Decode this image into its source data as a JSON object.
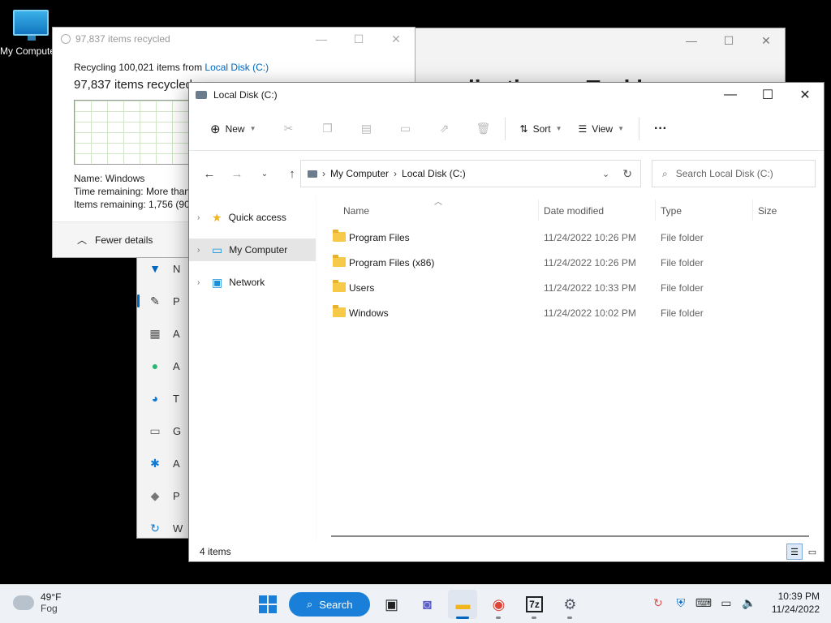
{
  "desktop": {
    "icon_label": "My Computer"
  },
  "settings_window": {
    "heading": "…lications > Taskb",
    "nav": [
      {
        "icon": "wifi-icon",
        "glyph": "▼",
        "color": "#0067c0",
        "label": "N"
      },
      {
        "icon": "brush-icon",
        "glyph": "✎",
        "color": "#333333",
        "label": "P",
        "selected": true
      },
      {
        "icon": "apps-icon",
        "glyph": "▦",
        "color": "#555555",
        "label": "A"
      },
      {
        "icon": "accounts-icon",
        "glyph": "●",
        "color": "#2bb673",
        "label": "A"
      },
      {
        "icon": "time-language-icon",
        "glyph": "◕",
        "color": "#0c7ad4",
        "label": "T"
      },
      {
        "icon": "gaming-icon",
        "glyph": "▭",
        "color": "#666666",
        "label": "G"
      },
      {
        "icon": "accessibility-icon",
        "glyph": "✱",
        "color": "#0c7ad4",
        "label": "A"
      },
      {
        "icon": "privacy-shield-icon",
        "glyph": "◆",
        "color": "#777777",
        "label": "P"
      },
      {
        "icon": "windows-update-icon",
        "glyph": "↻",
        "color": "#0c7ad4",
        "label": "W"
      }
    ]
  },
  "recycle_dialog": {
    "title": "97,837 items recycled",
    "line1_prefix": "Recycling 100,021 items from ",
    "line1_link": "Local Disk (C:)",
    "line2": "97,837 items recycled",
    "name_label": "Name:",
    "name_value": "Windows",
    "time_label": "Time remaining:",
    "time_value": "More than",
    "items_label": "Items remaining:",
    "items_value": "1,756 (90",
    "fewer_details": "Fewer details"
  },
  "explorer": {
    "title": "Local Disk (C:)",
    "toolbar": {
      "new": "New",
      "sort": "Sort",
      "view": "View",
      "more": "···"
    },
    "breadcrumb": [
      "My Computer",
      "Local Disk (C:)"
    ],
    "search_placeholder": "Search Local Disk (C:)",
    "nav_pane": [
      {
        "label": "Quick access",
        "icon": "star-icon"
      },
      {
        "label": "My Computer",
        "icon": "computer-icon",
        "selected": true
      },
      {
        "label": "Network",
        "icon": "network-icon"
      }
    ],
    "columns": {
      "name": "Name",
      "date": "Date modified",
      "type": "Type",
      "size": "Size"
    },
    "files": [
      {
        "name": "Program Files",
        "date": "11/24/2022 10:26 PM",
        "type": "File folder"
      },
      {
        "name": "Program Files (x86)",
        "date": "11/24/2022 10:26 PM",
        "type": "File folder"
      },
      {
        "name": "Users",
        "date": "11/24/2022 10:33 PM",
        "type": "File folder"
      },
      {
        "name": "Windows",
        "date": "11/24/2022 10:02 PM",
        "type": "File folder"
      }
    ],
    "status": "4 items"
  },
  "taskbar": {
    "weather_temp": "49°F",
    "weather_desc": "Fog",
    "search_label": "Search",
    "time": "10:39 PM",
    "date": "11/24/2022"
  }
}
